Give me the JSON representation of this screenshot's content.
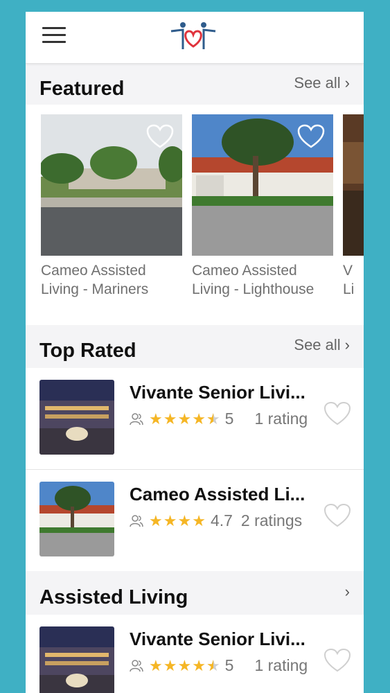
{
  "app": {
    "menu_icon": "hamburger-menu-icon",
    "logo_icon": "family-heart-logo"
  },
  "featured": {
    "title": "Featured",
    "see_all": "See all",
    "items": [
      {
        "name": "Cameo Assisted Living - Mariners",
        "name_line1": "Cameo Assisted",
        "name_line2": "Living - Mariners"
      },
      {
        "name": "Cameo Assisted Living - Lighthouse",
        "name_line1": "Cameo Assisted",
        "name_line2": "Living - Lighthouse"
      },
      {
        "name_line1": "V",
        "name_line2": "Li"
      }
    ]
  },
  "top_rated": {
    "title": "Top Rated",
    "see_all": "See all",
    "items": [
      {
        "name": "Vivante Senior Livi...",
        "stars": 4.5,
        "rating": "5",
        "rating_count": "1 rating"
      },
      {
        "name": "Cameo Assisted Li...",
        "stars": 4,
        "rating": "4.7",
        "rating_count": "2 ratings"
      }
    ]
  },
  "assisted_living": {
    "title": "Assisted Living",
    "items": [
      {
        "name": "Vivante Senior Livi...",
        "stars": 4.5,
        "rating": "5",
        "rating_count": "1 rating"
      }
    ]
  },
  "colors": {
    "background": "#3fb0c4",
    "star": "#f5b625",
    "logo_heart": "#e0333c",
    "logo_figures": "#2f5c8c"
  }
}
